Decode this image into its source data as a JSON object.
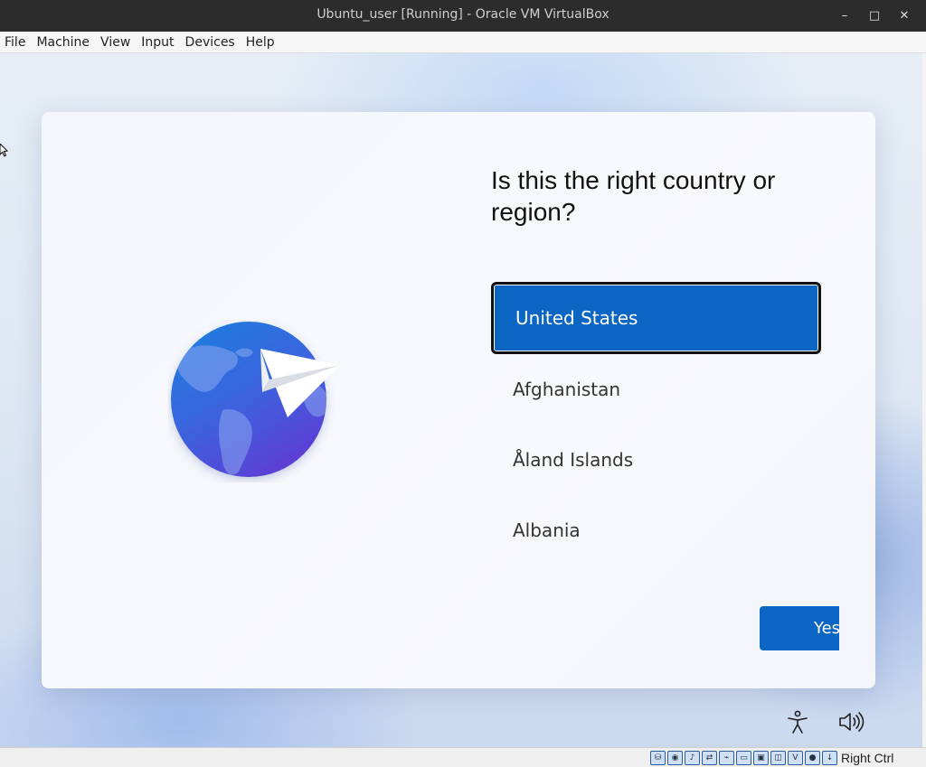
{
  "window": {
    "title": "Ubuntu_user [Running] - Oracle VM VirtualBox",
    "controls": {
      "minimize": "–",
      "maximize": "□",
      "close": "✕"
    }
  },
  "menubar": {
    "items": [
      {
        "label": "File"
      },
      {
        "label": "Machine"
      },
      {
        "label": "View"
      },
      {
        "label": "Input"
      },
      {
        "label": "Devices"
      },
      {
        "label": "Help"
      }
    ]
  },
  "oobe": {
    "heading": "Is this the right country or region?",
    "countries": [
      {
        "label": "United States",
        "selected": true
      },
      {
        "label": "Afghanistan",
        "selected": false
      },
      {
        "label": "Åland Islands",
        "selected": false
      },
      {
        "label": "Albania",
        "selected": false
      }
    ],
    "yes_button": "Yes",
    "accent": "#0a66c2"
  },
  "statusbar": {
    "icons": [
      "hard-disk-icon",
      "optical-drive-icon",
      "audio-icon",
      "network-icon",
      "usb-icon",
      "shared-folders-icon",
      "display-icon",
      "recording-icon",
      "vt-x-icon",
      "guest-additions-icon",
      "keyboard-capture-icon"
    ],
    "host_key": "Right Ctrl"
  }
}
